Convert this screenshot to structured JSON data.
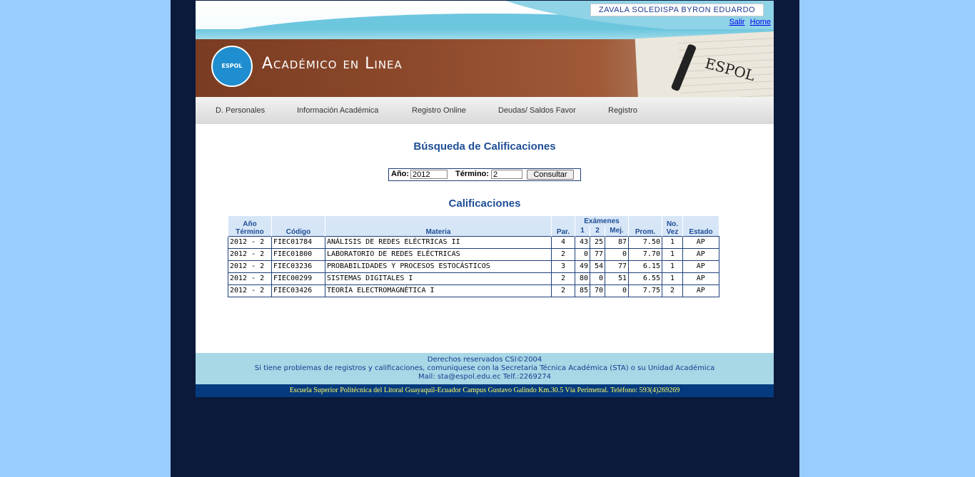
{
  "header": {
    "user_name": "ZAVALA SOLEDISPA BYRON EDUARDO",
    "links": [
      "Salir",
      "Home"
    ],
    "app_title": "Académico en Linea",
    "banner_word": "ESPOL",
    "logo_text": "ESPOL"
  },
  "nav": {
    "items": [
      "D. Personales",
      "Información Académica",
      "Registro Online",
      "Deudas/ Saldos Favor",
      "Registro"
    ]
  },
  "search": {
    "title": "Búsqueda de Calificaciones",
    "year_label": "Año:",
    "year_value": "2012",
    "term_label": "Término:",
    "term_value": "2",
    "submit_label": "Consultar"
  },
  "grades": {
    "title": "Calificaciones",
    "headers": {
      "year_term": "Año Término",
      "code": "Código",
      "subject": "Materia",
      "par": "Par.",
      "exams": "Exámenes",
      "e1": "1",
      "e2": "2",
      "best": "Mej.",
      "avg": "Prom.",
      "times": "No. Vez",
      "status": "Estado"
    },
    "rows": [
      {
        "year_term": "2012 - 2",
        "code": "FIEC01784",
        "subject": "ANÁLISIS DE REDES ELÉCTRICAS II",
        "par": "4",
        "e1": "43",
        "e2": "25",
        "best": "87",
        "avg": "7.50",
        "times": "1",
        "status": "AP"
      },
      {
        "year_term": "2012 - 2",
        "code": "FIEC01800",
        "subject": "LABORATORIO DE REDES ELÉCTRICAS",
        "par": "2",
        "e1": "0",
        "e2": "77",
        "best": "0",
        "avg": "7.70",
        "times": "1",
        "status": "AP"
      },
      {
        "year_term": "2012 - 2",
        "code": "FIEC03236",
        "subject": "PROBABILIDADES Y PROCESOS ESTOCÁSTICOS",
        "par": "3",
        "e1": "49",
        "e2": "54",
        "best": "77",
        "avg": "6.15",
        "times": "1",
        "status": "AP"
      },
      {
        "year_term": "2012 - 2",
        "code": "FIEC00299",
        "subject": "SISTEMAS DIGITALES I",
        "par": "2",
        "e1": "80",
        "e2": "0",
        "best": "51",
        "avg": "6.55",
        "times": "1",
        "status": "AP"
      },
      {
        "year_term": "2012 - 2",
        "code": "FIEC03426",
        "subject": "TEORÍA ELECTROMAGNÉTICA I",
        "par": "2",
        "e1": "85",
        "e2": "70",
        "best": "0",
        "avg": "7.75",
        "times": "2",
        "status": "AP"
      }
    ]
  },
  "footer": {
    "line1": "Derechos reservados CSI©2004",
    "line2": "Si tiene problemas de registros y calificaciones, comuniquese con la Secretaria Técnica Académica (STA) o su Unidad Académica",
    "line3": "Mail: sta@espol.edu.ec Telf.:2269274",
    "address": "Escuela Superior Politécnica del Litoral Guayaquil-Ecuador Campus Gustavo Galindo Km.30.5 Vía Perimetral. Teléfono: 593(4)269269"
  },
  "colors": {
    "page_bg": "#99ccff",
    "frame_bg": "#0b1a3a",
    "accent": "#1f4e96",
    "footer_bar": "#063a7e"
  }
}
